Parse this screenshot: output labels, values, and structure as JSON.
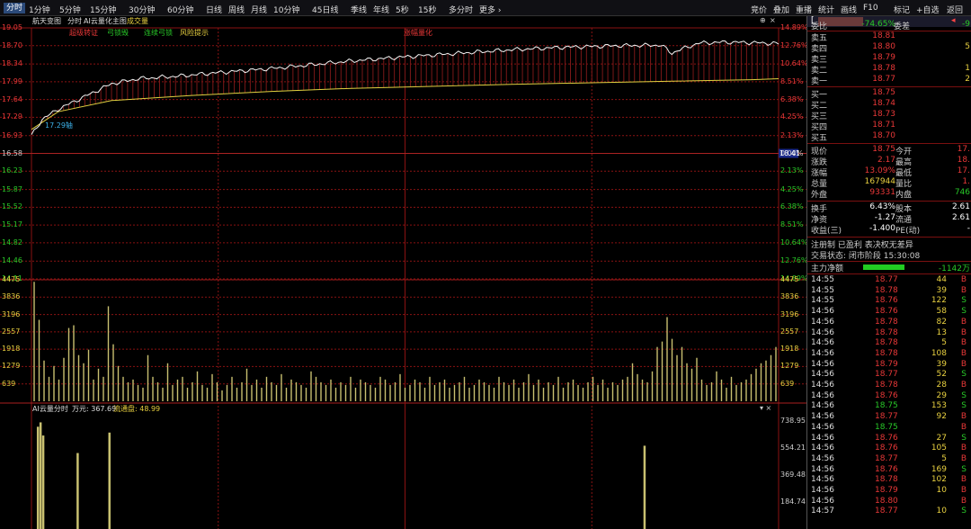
{
  "toolbar": {
    "tabs": [
      "分时",
      "1分钟",
      "5分钟",
      "15分钟",
      "30分钟",
      "60分钟",
      "日线",
      "周线",
      "月线",
      "10分钟",
      "45日线",
      "季线",
      "年线",
      "5秒",
      "15秒",
      "多分时",
      "更多 ›"
    ],
    "active": "分时",
    "right": [
      "竞价",
      "叠加",
      "重播",
      "统计",
      "画线",
      "F10",
      "标记",
      "+自选",
      "返回"
    ]
  },
  "chart_labels": {
    "stock": "航天变图",
    "tab1": "分时",
    "tab2": "AI云量化主图",
    "tab3": "成交量",
    "sig1": "超级转证",
    "sig2": "弓锁毁",
    "sig3": "连续弓锁",
    "sig4": "风险提示",
    "sig5": "涨幅量化",
    "avg_label": "17.29轴",
    "cursor_price": "18.41",
    "sub_title": "AI云量分时",
    "sub_unit": "万元: 367.69",
    "sub_flow": "流通盘: 48.99",
    "pane_close": "▾ ×"
  },
  "chart_data": [
    {
      "type": "line",
      "title": "分时",
      "price_ticks": [
        19.05,
        18.7,
        18.34,
        17.99,
        17.64,
        17.29,
        16.93,
        16.58,
        16.23,
        15.87,
        15.52,
        15.17,
        14.82,
        14.46,
        14.11
      ],
      "pct_ticks": [
        "14.89%",
        "12.76%",
        "10.64%",
        "8.51%",
        "6.38%",
        "4.25%",
        "2.13%",
        "0.00%",
        "2.13%",
        "4.25%",
        "6.38%",
        "8.51%",
        "10.64%",
        "12.76%",
        "14.89%"
      ],
      "prev_close": 16.58,
      "ylim": [
        14.11,
        19.05
      ],
      "series": [
        {
          "name": "价格",
          "x": [
            0,
            4,
            10,
            20,
            30,
            40,
            55,
            70,
            90,
            110,
            120,
            140,
            160,
            180,
            200,
            220,
            236,
            240,
            242,
            250,
            260,
            270,
            280
          ],
          "y": [
            16.93,
            17.25,
            17.45,
            17.7,
            17.95,
            18.05,
            18.1,
            18.17,
            18.25,
            18.35,
            18.4,
            18.48,
            18.55,
            18.62,
            18.67,
            18.7,
            18.71,
            18.55,
            18.6,
            18.75,
            18.77,
            18.76,
            18.74
          ]
        },
        {
          "name": "均价",
          "x": [
            0,
            10,
            30,
            60,
            90,
            120,
            150,
            180,
            210,
            240,
            270,
            280
          ],
          "y": [
            17.05,
            17.4,
            17.62,
            17.72,
            17.8,
            17.86,
            17.9,
            17.94,
            17.97,
            18.0,
            18.03,
            18.05
          ]
        }
      ]
    },
    {
      "type": "bar",
      "title": "成交量",
      "ticks": [
        4475,
        3836,
        3196,
        2557,
        1918,
        1279,
        639
      ],
      "ylim": [
        0,
        4475
      ],
      "values": [
        4400,
        3000,
        1500,
        900,
        1300,
        800,
        1600,
        2700,
        2800,
        1700,
        1400,
        1900,
        800,
        1200,
        900,
        3500,
        2100,
        1300,
        900,
        700,
        800,
        600,
        500,
        1700,
        900,
        700,
        500,
        1400,
        600,
        800,
        900,
        500,
        700,
        1100,
        600,
        500,
        1000,
        700,
        400,
        600,
        900,
        500,
        700,
        1200,
        600,
        800,
        500,
        900,
        700,
        600,
        1000,
        500,
        800,
        700,
        600,
        500,
        1100,
        900,
        700,
        600,
        800,
        500,
        700,
        600,
        900,
        500,
        800,
        700,
        600,
        500,
        900,
        800,
        600,
        700,
        1000,
        500,
        600,
        800,
        700,
        500,
        900,
        600,
        700,
        800,
        500,
        600,
        700,
        900,
        500,
        600,
        800,
        700,
        600,
        500,
        900,
        700,
        600,
        800,
        500,
        700,
        1000,
        600,
        800,
        500,
        700,
        600,
        900,
        500,
        700,
        800,
        600,
        500,
        700,
        900,
        600,
        800,
        500,
        700,
        600,
        800,
        900,
        1400,
        1000,
        800,
        700,
        1100,
        2000,
        2200,
        3100,
        2300,
        1700,
        2000,
        1400,
        1200,
        1600,
        800,
        600,
        700,
        1100,
        800,
        500,
        900,
        600,
        700,
        800,
        1000,
        1200,
        1400,
        1500,
        1700,
        2000
      ]
    },
    {
      "type": "bar",
      "title": "AI云量分时",
      "ticks": [
        738.95,
        554.21,
        369.48,
        184.74
      ],
      "ylim": [
        0,
        738.95
      ],
      "values": [
        {
          "x": 1,
          "v": 700
        },
        {
          "x": 2,
          "v": 730
        },
        {
          "x": 3,
          "v": 640
        },
        {
          "x": 16,
          "v": 520
        },
        {
          "x": 28,
          "v": 660
        },
        {
          "x": 230,
          "v": 570
        }
      ]
    }
  ],
  "quote": {
    "title": "",
    "wb_label": "委比",
    "wb_val": "-74.65%",
    "wc_label": "委差",
    "wc_val": "-9",
    "asks": [
      {
        "l": "卖五",
        "p": "18.81",
        "v": ""
      },
      {
        "l": "卖四",
        "p": "18.80",
        "v": "5"
      },
      {
        "l": "卖三",
        "p": "18.79",
        "v": ""
      },
      {
        "l": "卖二",
        "p": "18.78",
        "v": "1"
      },
      {
        "l": "卖一",
        "p": "18.77",
        "v": "2"
      }
    ],
    "bids": [
      {
        "l": "买一",
        "p": "18.75",
        "v": ""
      },
      {
        "l": "买二",
        "p": "18.74",
        "v": ""
      },
      {
        "l": "买三",
        "p": "18.73",
        "v": ""
      },
      {
        "l": "买四",
        "p": "18.71",
        "v": ""
      },
      {
        "l": "买五",
        "p": "18.70",
        "v": ""
      }
    ],
    "stats": [
      {
        "a": "现价",
        "av": "18.75",
        "b": "今开",
        "bv": "17."
      },
      {
        "a": "涨跌",
        "av": "2.17",
        "b": "最高",
        "bv": "18."
      },
      {
        "a": "涨幅",
        "av": "13.09%",
        "b": "最低",
        "bv": "17."
      },
      {
        "a": "总量",
        "av": "167944",
        "b": "量比",
        "bv": "1."
      },
      {
        "a": "外盘",
        "av": "93331",
        "b": "内盘",
        "bv": "746"
      }
    ],
    "stats2": [
      {
        "a": "换手",
        "av": "6.43%",
        "b": "股本",
        "bv": "2.61"
      },
      {
        "a": "净资",
        "av": "-1.27",
        "b": "流通",
        "bv": "2.61"
      },
      {
        "a": "收益(三)",
        "av": "-1.400",
        "b": "PE(动)",
        "bv": "-"
      }
    ],
    "notice": "注册制 已盈利 表决权无差异",
    "status": "交易状态: 闭市阶段 15:30:08",
    "flow_label": "主力净额",
    "flow_val": "-1142万"
  },
  "trades": [
    [
      "14:55",
      "18.77",
      "44",
      "B"
    ],
    [
      "14:55",
      "18.78",
      "39",
      "B"
    ],
    [
      "14:55",
      "18.76",
      "122",
      "S"
    ],
    [
      "14:56",
      "18.76",
      "58",
      "S"
    ],
    [
      "14:56",
      "18.78",
      "82",
      "B"
    ],
    [
      "14:56",
      "18.78",
      "13",
      "B"
    ],
    [
      "14:56",
      "18.78",
      "5",
      "B"
    ],
    [
      "14:56",
      "18.78",
      "108",
      "B"
    ],
    [
      "14:56",
      "18.79",
      "39",
      "B"
    ],
    [
      "14:56",
      "18.77",
      "52",
      "S"
    ],
    [
      "14:56",
      "18.78",
      "28",
      "B"
    ],
    [
      "14:56",
      "18.76",
      "29",
      "S"
    ],
    [
      "14:56",
      "18.75",
      "153",
      "S"
    ],
    [
      "14:56",
      "18.77",
      "92",
      "B"
    ],
    [
      "14:56",
      "18.75",
      "",
      "B"
    ],
    [
      "14:56",
      "18.76",
      "27",
      "S"
    ],
    [
      "14:56",
      "18.76",
      "105",
      "B"
    ],
    [
      "14:56",
      "18.77",
      "5",
      "B"
    ],
    [
      "14:56",
      "18.76",
      "169",
      "S"
    ],
    [
      "14:56",
      "18.78",
      "102",
      "B"
    ],
    [
      "14:56",
      "18.79",
      "10",
      "B"
    ],
    [
      "14:56",
      "18.80",
      "",
      "B"
    ],
    [
      "14:57",
      "18.77",
      "10",
      "S"
    ]
  ]
}
